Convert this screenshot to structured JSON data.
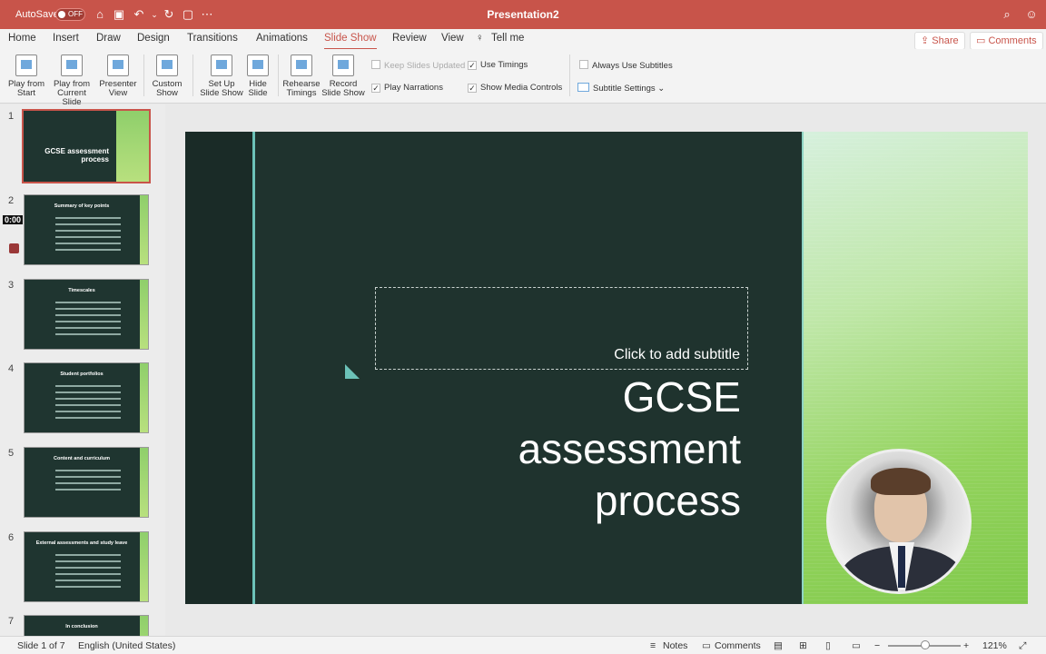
{
  "titlebar": {
    "autosave_label": "AutoSave",
    "autosave_state": "OFF",
    "doc_title": "Presentation2",
    "icons": [
      "home-icon",
      "save-icon",
      "undo-icon",
      "redo-icon",
      "new-doc-icon",
      "more-icon",
      "search-icon",
      "smiley-icon"
    ]
  },
  "tabs": [
    "Home",
    "Insert",
    "Draw",
    "Design",
    "Transitions",
    "Animations",
    "Slide Show",
    "Review",
    "View",
    "Tell me"
  ],
  "active_tab": "Slide Show",
  "share_label": "Share",
  "comments_label": "Comments",
  "ribbon": {
    "play_from_start": "Play from Start",
    "play_from_current": "Play from Current Slide",
    "presenter_view": "Presenter View",
    "custom_show": "Custom Show",
    "set_up": "Set Up Slide Show",
    "hide_slide": "Hide Slide",
    "rehearse": "Rehearse Timings",
    "record": "Record Slide Show",
    "keep_updated": "Keep Slides Updated",
    "use_timings": "Use Timings",
    "play_narrations": "Play Narrations",
    "show_media": "Show Media Controls",
    "always_subtitles": "Always Use Subtitles",
    "subtitle_settings": "Subtitle Settings"
  },
  "thumbnails": [
    {
      "num": "1",
      "title": "GCSE assessment process"
    },
    {
      "num": "2",
      "title": "Summary of key points"
    },
    {
      "num": "3",
      "title": "Timescales"
    },
    {
      "num": "4",
      "title": "Student portfolios"
    },
    {
      "num": "5",
      "title": "Content and curriculum"
    },
    {
      "num": "6",
      "title": "External assessments and study leave"
    },
    {
      "num": "7",
      "title": "In conclusion"
    }
  ],
  "recording_timer": "0:00",
  "slide": {
    "subtitle_placeholder": "Click to add subtitle",
    "title_line1": "GCSE",
    "title_line2": "assessment",
    "title_line3": "process"
  },
  "statusbar": {
    "slide_info": "Slide 1 of 7",
    "language": "English (United States)",
    "notes": "Notes",
    "comments": "Comments",
    "zoom": "121%"
  }
}
